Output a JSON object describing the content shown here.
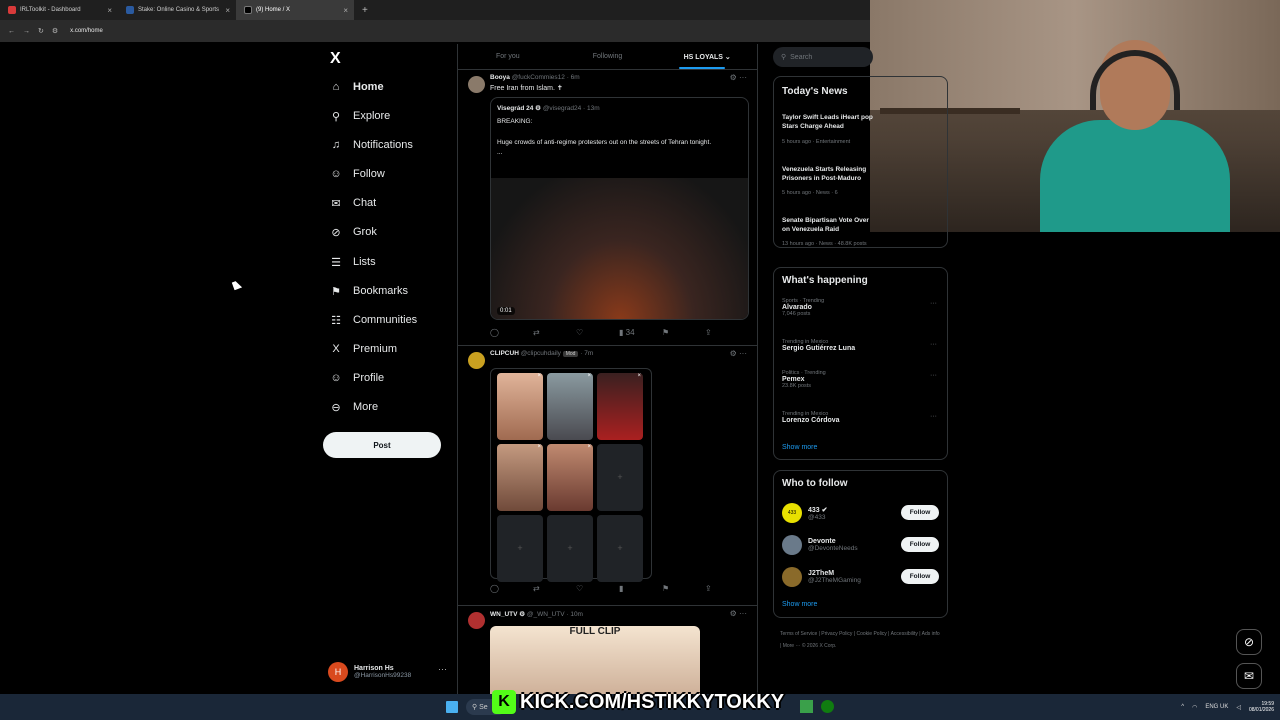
{
  "browser": {
    "tabs": [
      {
        "label": "IRLToolkit - Dashboard",
        "color": "#d93a3a"
      },
      {
        "label": "Stake: Online Casino & Sports",
        "color": "#2a5aa0"
      },
      {
        "label": "(9) Home / X",
        "color": "#000000"
      }
    ],
    "address": "x.com/home"
  },
  "sidebar": {
    "logo": "X",
    "items": [
      {
        "label": "Home",
        "icon": "home-icon",
        "glyph": "⌂"
      },
      {
        "label": "Explore",
        "icon": "search-icon",
        "glyph": "⚲"
      },
      {
        "label": "Notifications",
        "icon": "bell-icon",
        "glyph": "♫"
      },
      {
        "label": "Follow",
        "icon": "person-add-icon",
        "glyph": "☺"
      },
      {
        "label": "Chat",
        "icon": "mail-icon",
        "glyph": "✉"
      },
      {
        "label": "Grok",
        "icon": "grok-icon",
        "glyph": "⊘"
      },
      {
        "label": "Lists",
        "icon": "list-icon",
        "glyph": "☰"
      },
      {
        "label": "Bookmarks",
        "icon": "bookmark-icon",
        "glyph": "⚑"
      },
      {
        "label": "Communities",
        "icon": "people-icon",
        "glyph": "☷"
      },
      {
        "label": "Premium",
        "icon": "x-icon",
        "glyph": "X"
      },
      {
        "label": "Profile",
        "icon": "person-icon",
        "glyph": "☺"
      },
      {
        "label": "More",
        "icon": "more-icon",
        "glyph": "⊖"
      }
    ],
    "post_label": "Post",
    "account": {
      "initial": "H",
      "name": "Harrison Hs",
      "handle": "@HarrisonHs99238"
    }
  },
  "feed": {
    "tabs": [
      "For you",
      "Following",
      "HS LOYALS ⌄"
    ],
    "tweets": [
      {
        "author": "Booya",
        "handle": "@fuckCommies12 · 6m",
        "text": "Free Iran from Islam. ✝",
        "quote": {
          "author": "Visegrád 24 ⚙",
          "handle": "@visegrad24 · 13m",
          "line1": "BREAKING:",
          "line2": "Huge crowds of anti-regime protesters out on the streets of Tehran tonight.",
          "line3": "...",
          "video_time": "0:01"
        },
        "views": "34"
      },
      {
        "author": "CLIPCUH",
        "handle": "@clipcuhdaily",
        "badge": "Mod",
        "time": "· 7m"
      },
      {
        "author": "WN_UTV ⚙",
        "handle": "@_WN_UTV · 10m",
        "thumb_text": "FULL CLIP"
      }
    ]
  },
  "right": {
    "search_placeholder": "Search",
    "news": {
      "title": "Today's News",
      "items": [
        {
          "headline": "Taylor Swift Leads iHeart pop Stars Charge Ahead",
          "meta": "5 hours ago · Entertainment"
        },
        {
          "headline": "Venezuela Starts Releasing Prisoners in Post-Maduro",
          "meta": "5 hours ago · News · 6"
        },
        {
          "headline": "Senate Bipartisan Vote Over on Venezuela Raid",
          "meta": "13 hours ago · News · 48.8K posts"
        }
      ]
    },
    "happening": {
      "title": "What's happening",
      "items": [
        {
          "context": "Sports · Trending",
          "name": "Alvarado",
          "count": "7,046 posts"
        },
        {
          "context": "Trending in Mexico",
          "name": "Sergio Gutiérrez Luna",
          "count": ""
        },
        {
          "context": "Politics · Trending",
          "name": "Pemex",
          "count": "23.8K posts"
        },
        {
          "context": "Trending in Mexico",
          "name": "Lorenzo Córdova",
          "count": ""
        }
      ],
      "show_more": "Show more"
    },
    "who_to_follow": {
      "title": "Who to follow",
      "items": [
        {
          "name": "433 ✔",
          "handle": "@433",
          "btn": "Follow",
          "avatar_color": "#e8e000"
        },
        {
          "name": "Devonte",
          "handle": "@DevonteNeeds",
          "btn": "Follow",
          "avatar_color": "#6a7a8a"
        },
        {
          "name": "J2TheM",
          "handle": "@J2TheMGaming",
          "btn": "Follow",
          "avatar_color": "#8a6a2a"
        }
      ],
      "show_more": "Show more"
    },
    "footer": "Terms of Service | Privacy Policy | Cookie Policy | Accessibility | Ads info | More ··· © 2026 X Corp."
  },
  "overlay": {
    "kick_text": "KICK.COM/HSTIKKYTOKKY",
    "kick_logo": "K"
  },
  "taskbar": {
    "search": "Se",
    "lang": "ENG UK",
    "time": "19:59",
    "date": "08/01/2026"
  }
}
